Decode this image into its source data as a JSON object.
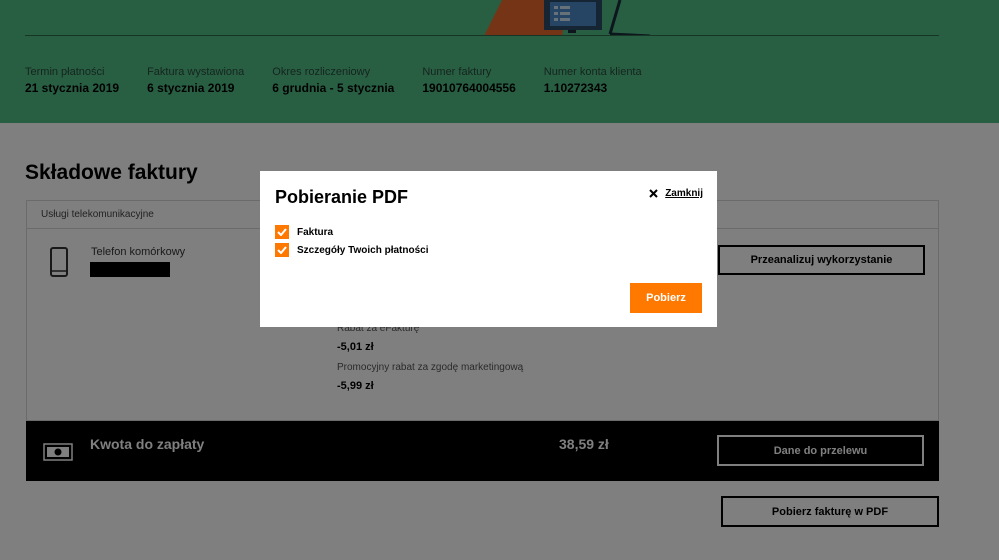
{
  "colors": {
    "hero_bg": "#50be87",
    "accent": "#ff7900",
    "overlay": "rgba(0,0,0,0.5)"
  },
  "header_info": [
    {
      "label": "Termin płatności",
      "value": "21 stycznia 2019"
    },
    {
      "label": "Faktura wystawiona",
      "value": "6 stycznia 2019"
    },
    {
      "label": "Okres rozliczeniowy",
      "value": "6 grudnia - 5 stycznia"
    },
    {
      "label": "Numer faktury",
      "value": "19010764004556"
    },
    {
      "label": "Numer konta klienta",
      "value": "1.10272343"
    }
  ],
  "section": {
    "title": "Składowe faktury",
    "card_header": "Usługi telekomunikacyjne",
    "phone_label": "Telefon komórkowy",
    "phone_icon": "mobile-phone-icon",
    "charges": [
      {
        "label": "Rabat za eFakturę",
        "value": "-5,01 zł"
      },
      {
        "label": "Promocyjny rabat za zgodę marketingową",
        "value": "-5,99 zł"
      }
    ],
    "analyze_button": "Przeanalizuj wykorzystanie"
  },
  "total": {
    "icon": "money-icon",
    "label": "Kwota do zapłaty",
    "amount": "38,59 zł",
    "transfer_button": "Dane do przelewu"
  },
  "download_pdf_button": "Pobierz fakturę w PDF",
  "modal": {
    "title": "Pobieranie PDF",
    "close_label": "Zamknij",
    "close_icon": "close-icon",
    "options": [
      {
        "label": "Faktura",
        "checked": true
      },
      {
        "label": "Szczegóły Twoich płatności",
        "checked": true
      }
    ],
    "submit_button": "Pobierz"
  }
}
